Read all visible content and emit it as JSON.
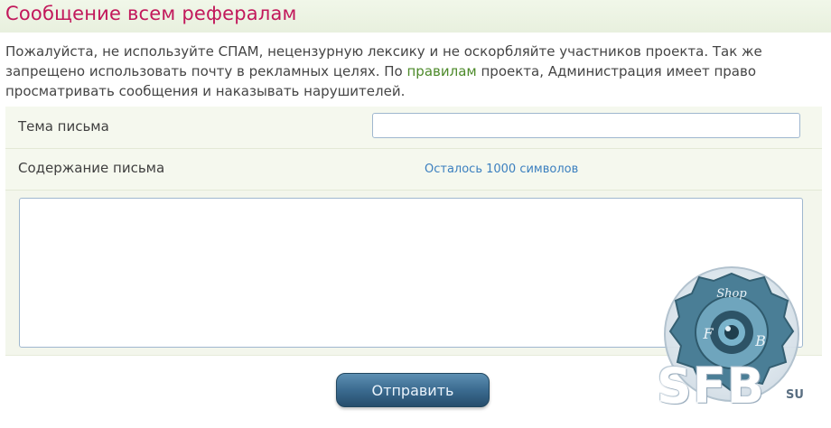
{
  "page": {
    "title": "Сообщение всем рефералам",
    "notice_before_link": "Пожалуйста, не используйте СПАМ, нецензурную лексику и не оскорбляйте участников проекта. Так же запрещено использовать почту в рекламных целях. По ",
    "notice_link": "правилам",
    "notice_after_link": " проекта, Администрация имеет право просматривать сообщения и наказывать нарушителей."
  },
  "form": {
    "subject_label": "Тема письма",
    "subject_value": "",
    "body_label": "Содержание письма",
    "remaining_text": "Осталось 1000 символов",
    "body_value": "",
    "submit_label": "Отправить"
  },
  "watermark": {
    "badge_top": "Shop",
    "badge_left": "F",
    "badge_right": "B",
    "main_text": "SFB",
    "suffix": "SU"
  },
  "colors": {
    "title": "#c2185b",
    "link": "#4d8a2a",
    "counter": "#3b7fbf",
    "button": "#3b6b90",
    "row_bg": "#f5f8ee"
  },
  "icons": {
    "watermark_center": "gear-lens-icon"
  }
}
